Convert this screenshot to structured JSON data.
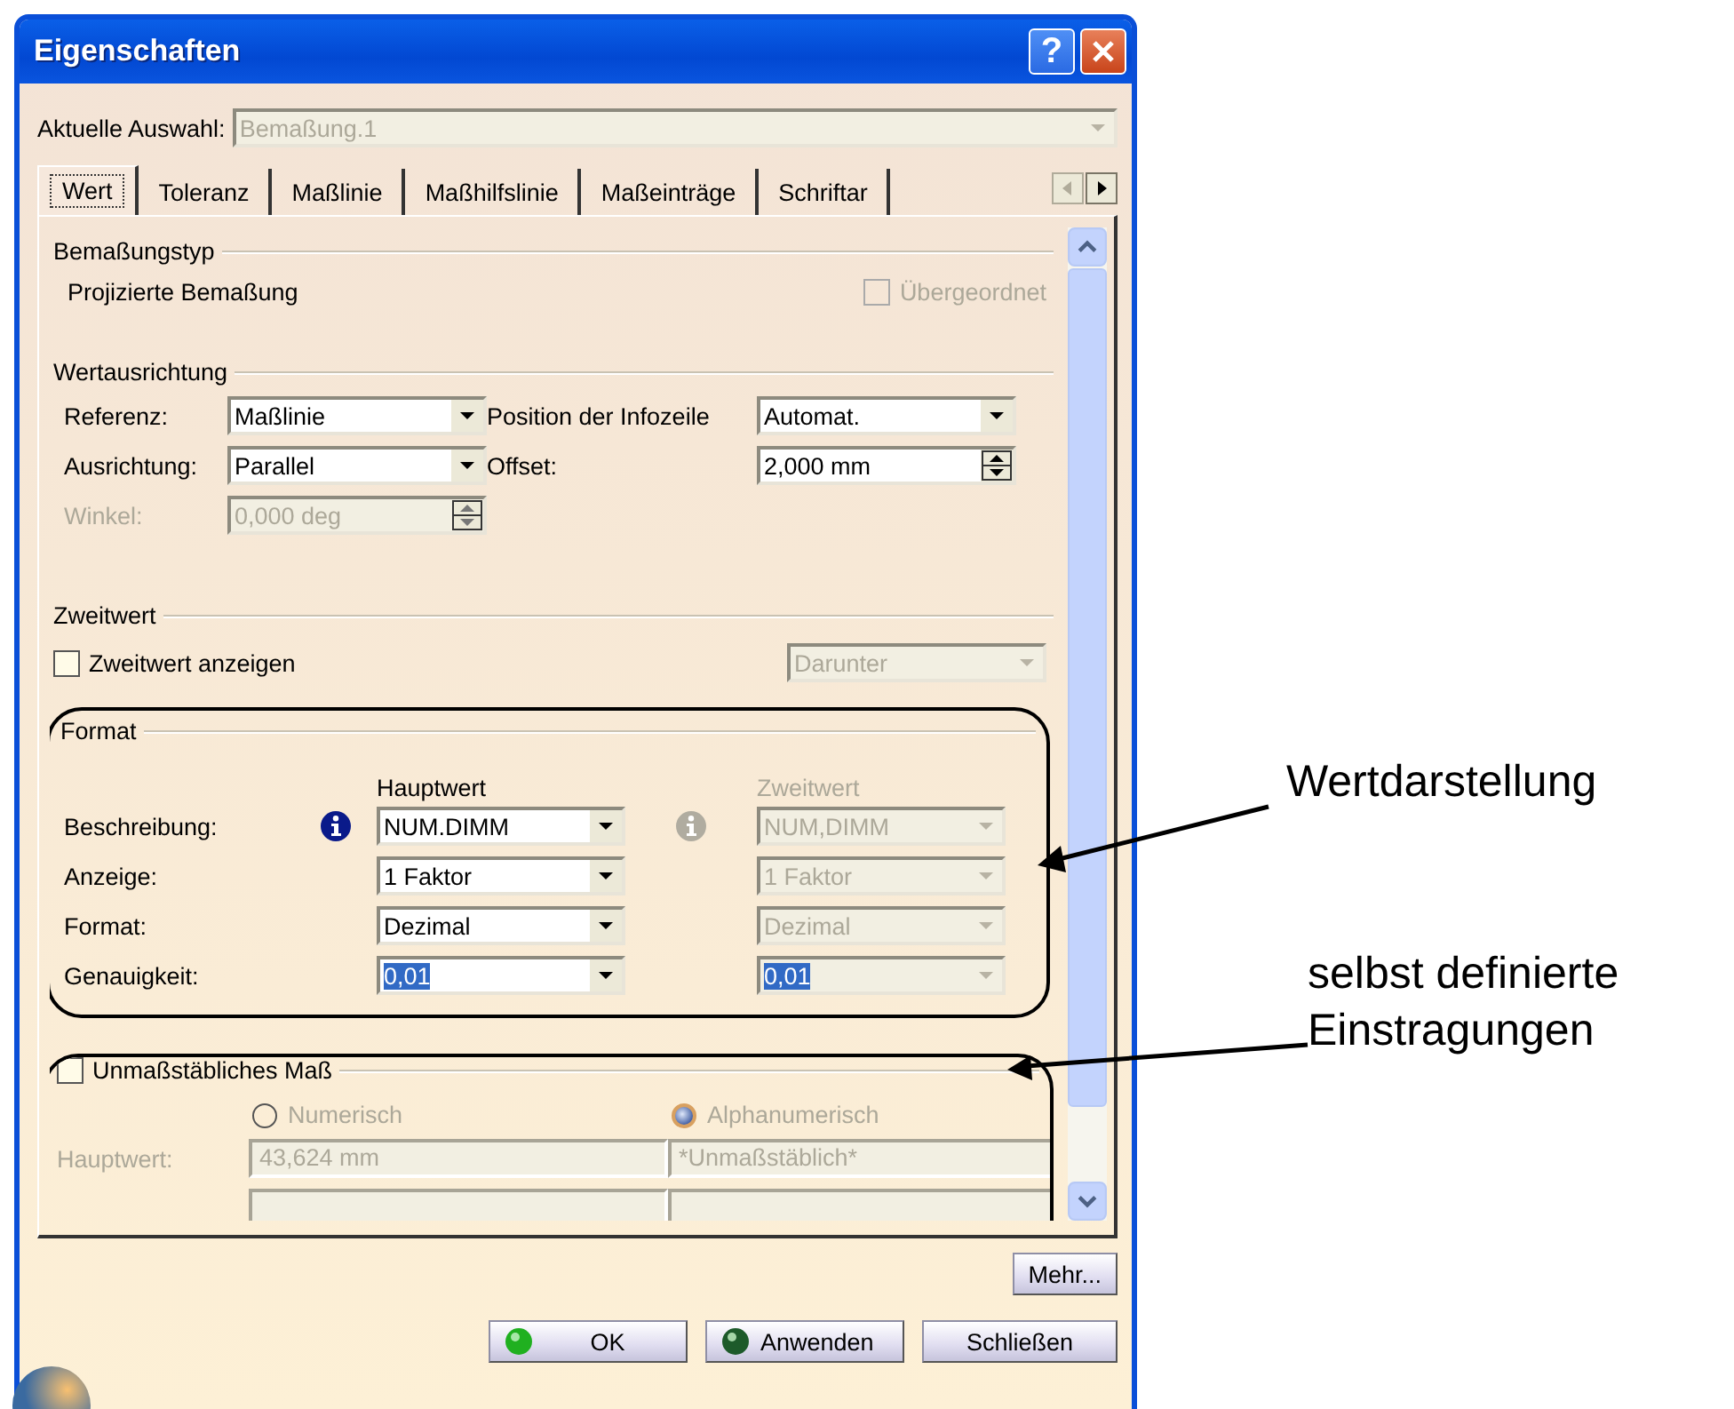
{
  "window": {
    "title": "Eigenschaften",
    "help": "?"
  },
  "current_selection": {
    "label": "Aktuelle Auswahl:",
    "value": "Bemaßung.1",
    "disabled": true
  },
  "tabs": [
    {
      "label": "Wert",
      "selected": true
    },
    {
      "label": "Toleranz",
      "selected": false
    },
    {
      "label": "Maßlinie",
      "selected": false
    },
    {
      "label": "Maßhilfslinie",
      "selected": false
    },
    {
      "label": "Maßeinträge",
      "selected": false
    },
    {
      "label": "Schriftar",
      "selected": false
    }
  ],
  "dimension_type": {
    "title": "Bemaßungstyp",
    "value": "Projizierte Bemaßung",
    "checkbox": {
      "label": "Übergeordnet",
      "checked": false,
      "disabled": true
    }
  },
  "value_orientation": {
    "title": "Wertausrichtung",
    "fields": [
      {
        "label": "Referenz:",
        "value": "Maßlinie",
        "kind": "dropdown",
        "disabled": false
      },
      {
        "label": "Position der Infozeile",
        "value": "Automat.",
        "kind": "dropdown",
        "disabled": false
      },
      {
        "label": "Ausrichtung:",
        "value": "Parallel",
        "kind": "dropdown",
        "disabled": false
      },
      {
        "label": "Offset:",
        "value": "2,000 mm",
        "kind": "spinner",
        "disabled": false
      },
      {
        "label": "Winkel:",
        "value": "0,000 deg",
        "kind": "spinner",
        "disabled": true
      }
    ]
  },
  "secondary_value": {
    "title": "Zweitwert",
    "checkbox": {
      "label": "Zweitwert anzeigen",
      "checked": false,
      "disabled": false
    },
    "dropdown": {
      "value": "Darunter",
      "disabled": true
    }
  },
  "format": {
    "title": "Format",
    "columns": [
      {
        "label": "Hauptwert",
        "disabled": false
      },
      {
        "label": "Zweitwert",
        "disabled": true
      }
    ],
    "rows": [
      {
        "label": "Beschreibung:",
        "info": true,
        "values": [
          "NUM.DIMM",
          "NUM,DIMM"
        ],
        "highlighted": false
      },
      {
        "label": "Anzeige:",
        "info": false,
        "values": [
          "1 Faktor",
          "1 Faktor"
        ],
        "highlighted": false
      },
      {
        "label": "Format:",
        "info": false,
        "values": [
          "Dezimal",
          "Dezimal"
        ],
        "highlighted": false
      },
      {
        "label": "Genauigkeit:",
        "info": false,
        "values": [
          "0,01",
          "0,01"
        ],
        "highlighted": true
      }
    ]
  },
  "unscaled": {
    "checkbox": {
      "label": "Unmaßstäbliches Maß",
      "checked": false,
      "disabled": false
    },
    "disabled": true,
    "options": [
      {
        "label": "Numerisch",
        "selected": false
      },
      {
        "label": "Alphanumerisch",
        "selected": true
      }
    ],
    "rows": [
      {
        "label": "Hauptwert:",
        "values": [
          "43,624 mm",
          "*Unmaßstäblich*"
        ]
      }
    ]
  },
  "more_button": "Mehr...",
  "buttons": [
    {
      "label": "OK",
      "kind": "ok"
    },
    {
      "label": "Anwenden",
      "kind": "apply"
    },
    {
      "label": "Schließen",
      "kind": "plain"
    }
  ],
  "annotations": [
    {
      "text": "Wertdarstellung"
    },
    {
      "text": "selbst definierte\nEinstragungen"
    }
  ]
}
